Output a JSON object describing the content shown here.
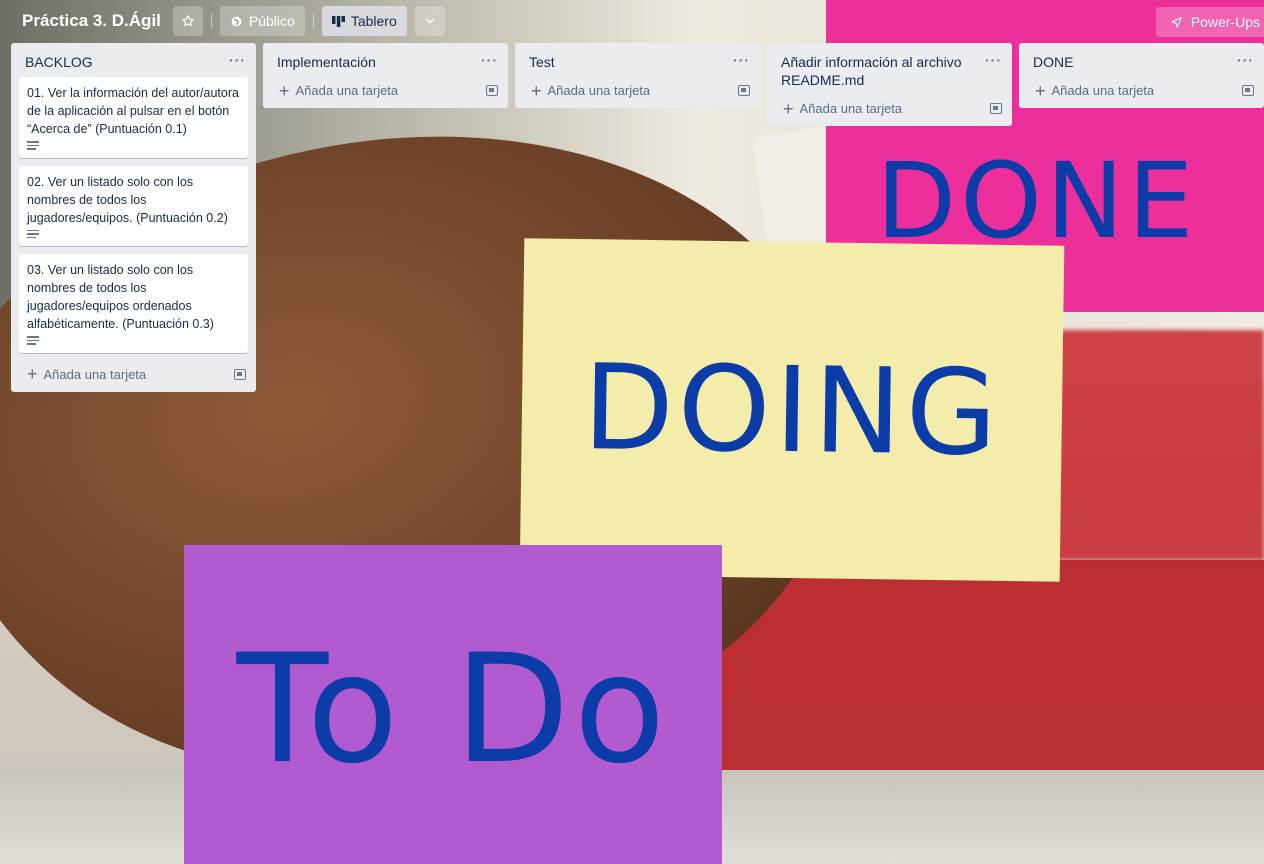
{
  "header": {
    "board_title": "Práctica 3. D.Ágil",
    "visibility_label": "Público",
    "view_label": "Tablero",
    "powerups_label": "Power-Ups"
  },
  "background": {
    "notes": [
      {
        "text": "DONE",
        "color": "#ec2f9a"
      },
      {
        "text": "DOING",
        "color": "#f4ecaa"
      },
      {
        "text": "To Do",
        "color": "#b25ad0"
      }
    ]
  },
  "lists": [
    {
      "title": "BACKLOG",
      "cards": [
        {
          "text": "01. Ver la información del autor/autora de la aplicación al pulsar en el botón “Acerca de” (Puntuación 0.1)"
        },
        {
          "text": "02. Ver un listado solo con los nombres de todos los jugadores/equipos. (Puntuación 0.2)"
        },
        {
          "text": "03. Ver un listado solo con los nombres de todos los jugadores/equipos ordenados alfabéticamente. (Puntuación 0.3)"
        }
      ],
      "add_label": "Añada una tarjeta"
    },
    {
      "title": "Implementación",
      "cards": [],
      "add_label": "Añada una tarjeta"
    },
    {
      "title": "Test",
      "cards": [],
      "add_label": "Añada una tarjeta"
    },
    {
      "title": "Añadir información al archivo README.md",
      "cards": [],
      "add_label": "Añada una tarjeta"
    },
    {
      "title": "DONE",
      "cards": [],
      "add_label": "Añada una tarjeta"
    }
  ],
  "icons": {
    "star": "star-icon",
    "globe": "globe-icon",
    "board": "board-icon",
    "chevron": "chevron-down-icon",
    "rocket": "rocket-icon",
    "more": "more-icon",
    "plus": "plus-icon",
    "template": "template-icon",
    "description": "description-icon"
  }
}
